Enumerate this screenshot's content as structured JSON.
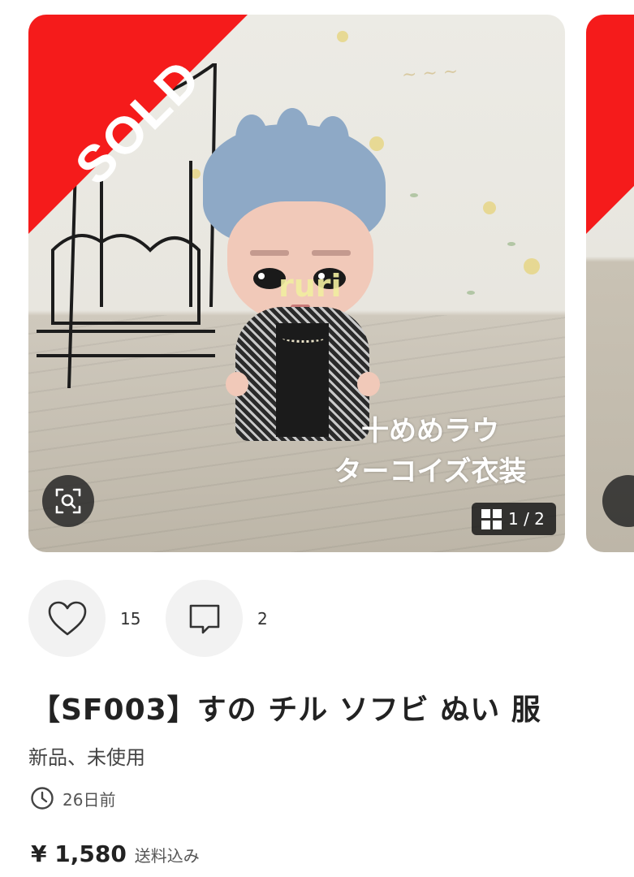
{
  "gallery": {
    "sold_label": "SOLD",
    "watermark": "ruri",
    "caption_lines": [
      "十めめラウ",
      "ターコイズ衣装"
    ],
    "counter": "1 / 2",
    "current_image": 1,
    "total_images": 2,
    "zoom_icon": "zoom-scan-icon",
    "grid_icon": "grid-icon",
    "sold_color": "#f51b1b"
  },
  "actions": {
    "like_icon": "heart-icon",
    "like_count": "15",
    "comment_icon": "comment-icon",
    "comment_count": "2"
  },
  "item": {
    "title": "【SF003】すの チル ソフビ ぬい 服",
    "condition": "新品、未使用",
    "posted": "26日前",
    "price": "¥ 1,580",
    "shipping": "送料込み"
  }
}
